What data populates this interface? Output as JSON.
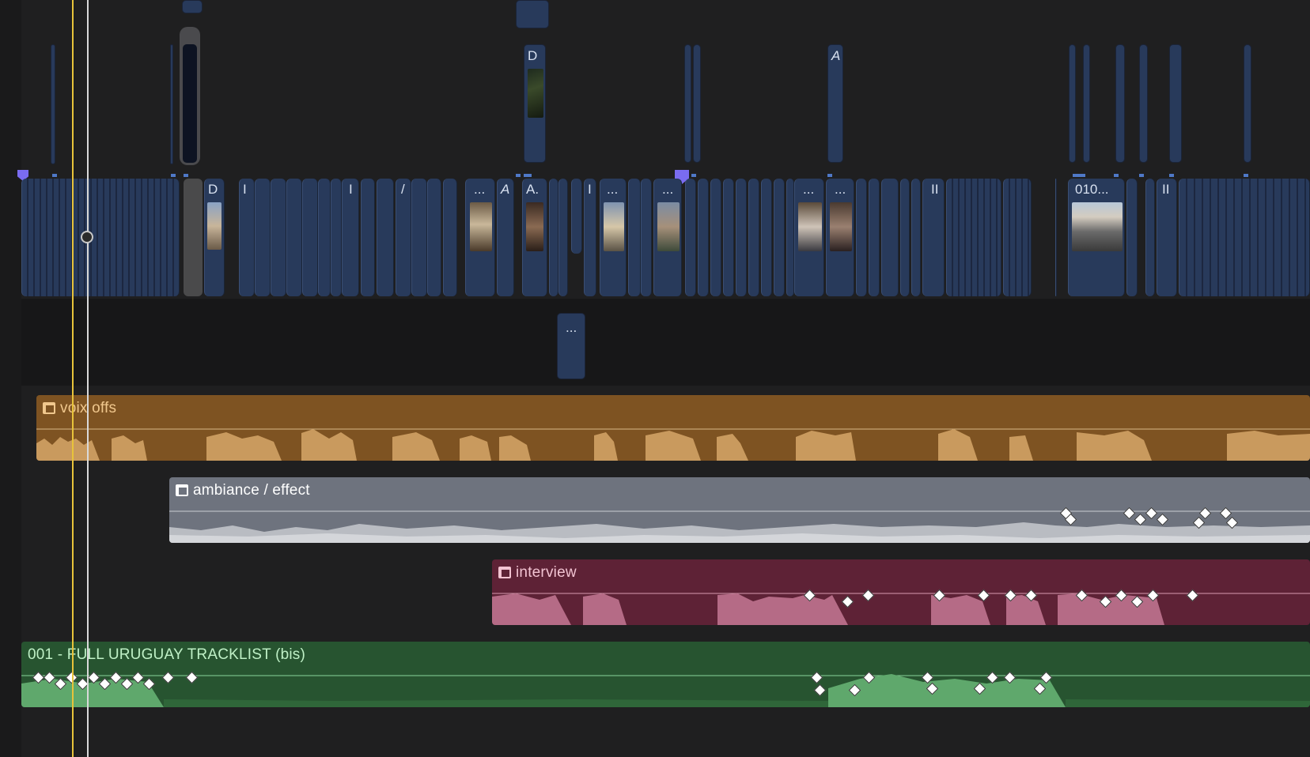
{
  "timeline": {
    "primary_storyline_titles": [
      "D",
      "I",
      "I",
      "/",
      "...",
      "A",
      "A.",
      "I",
      "...",
      "...",
      "...",
      "...",
      "II",
      "010...",
      "II"
    ],
    "connected_titles": [
      "D",
      "A"
    ],
    "lower_connected_title": "..."
  },
  "lanes": [
    {
      "name": "voix offs",
      "color": "#7e5322",
      "wave_color": "#c99a5e",
      "text_color": "#f0c78d"
    },
    {
      "name": "ambiance / effect",
      "color": "#6e737e",
      "wave_color": "#b9bcc2",
      "text_color": "#ffffff"
    },
    {
      "name": "interview",
      "color": "#5e2236",
      "wave_color": "#b56b86",
      "text_color": "#f2c3d2"
    },
    {
      "name": "001 - FULL URUGUAY TRACKLIST (bis)",
      "color": "#275430",
      "wave_color": "#5fa86c",
      "text_color": "#bff0c6"
    }
  ],
  "icons": {
    "lane_icon": "audio-lane-icon",
    "marker": "marker-icon",
    "skimmer": "skimmer-handle-icon"
  },
  "colors": {
    "background": "#1f1f20",
    "clip": "#283a5b",
    "playhead": "#e8c33a",
    "skimmer": "#d9d9d9",
    "marker": "#7a6cf0"
  }
}
